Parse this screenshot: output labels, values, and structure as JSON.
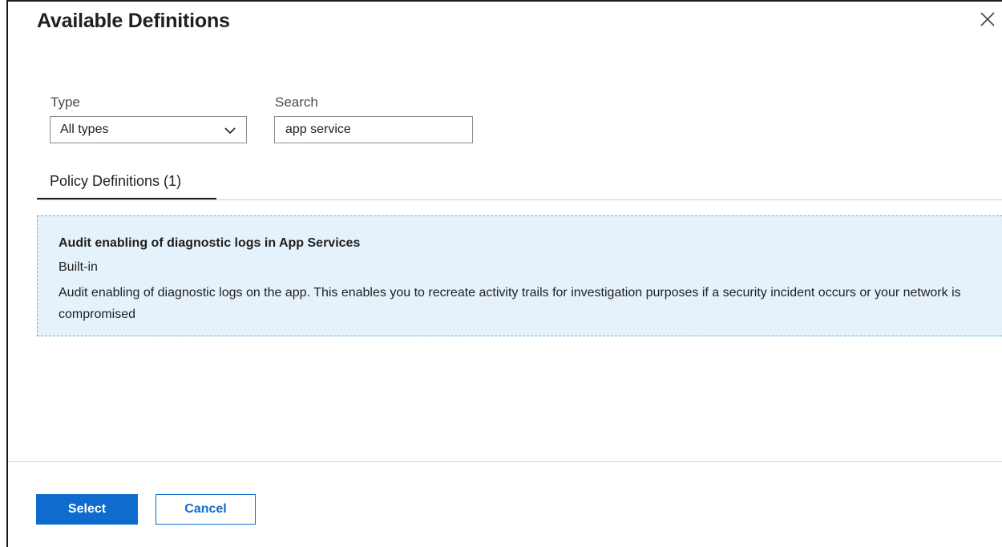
{
  "dialog": {
    "title": "Available Definitions"
  },
  "filters": {
    "type": {
      "label": "Type",
      "selected": "All types"
    },
    "search": {
      "label": "Search",
      "value": "app service"
    }
  },
  "tabs": [
    {
      "label": "Policy Definitions (1)",
      "active": true
    }
  ],
  "results": [
    {
      "title": "Audit enabling of diagnostic logs in App Services",
      "subtitle": "Built-in",
      "description": "Audit enabling of diagnostic logs on the app. This enables you to recreate activity trails for investigation purposes if a security incident occurs or your network is compromised"
    }
  ],
  "footer": {
    "select_label": "Select",
    "cancel_label": "Cancel"
  },
  "icons": {
    "close": "close-icon",
    "dropdown": "chevron-down-icon"
  },
  "colors": {
    "primary": "#0f6ccf",
    "card_background": "#e6f2fb",
    "card_border": "#6aaed6"
  }
}
